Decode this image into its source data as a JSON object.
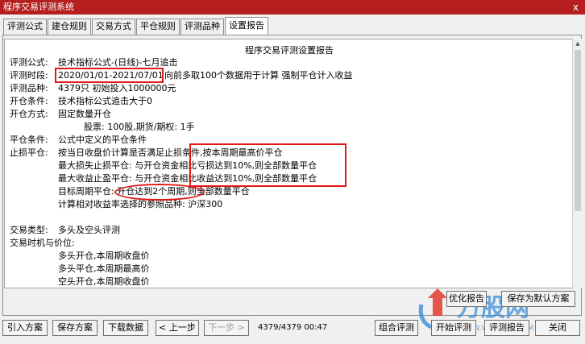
{
  "window": {
    "title": "程序交易评测系统",
    "close": "x"
  },
  "tabs": [
    "评测公式",
    "建仓规则",
    "交易方式",
    "平仓规则",
    "评测品种",
    "设置报告"
  ],
  "report": {
    "title": "程序交易评测设置报告",
    "formula_label": "评测公式:",
    "formula_value": "技术指标公式-(日线)-七月追击",
    "period_label": "评测时段:",
    "period_dates": "2020/01/01-2021/07/01",
    "period_rest": "向前多取100个数据用于计算 强制平仓计入收益",
    "symbols_label": "评测品种:",
    "symbols_value": "4379只 初始投入1000000元",
    "open_cond_label": "开仓条件:",
    "open_cond_value": "技术指标公式追击大于0",
    "open_method_label": "开仓方式:",
    "open_method_value": "固定数量开仓",
    "open_method_detail": "股票: 100股,期货/期权: 1手",
    "close_cond_label": "平仓条件:",
    "close_cond_value": "公式中定义的平仓条件",
    "stop_label": "止损平仓:",
    "stop_line1": "按当日收盘价计算是否满足止损条件,按本周期最高价平仓",
    "stop_line2": "最大损失止损平仓: 与开仓资金相比亏损达到10%,则全部数量平仓",
    "stop_line3": "最大收益止盈平仓: 与开仓资金相比收益达到10%,则全部数量平仓",
    "stop_line4": "目标周期平仓: 开仓达到2个周期,则全部数量平仓",
    "stop_line5": "计算相对收益率选择的参照品种: 沪深300",
    "trade_type_label": "交易类型:",
    "trade_type_value": "多头及空头评测",
    "timing_label": "交易时机与价位:",
    "timing_1": "多头开仓,本周期收盘价",
    "timing_2": "多头平仓,本周期最高价",
    "timing_3": "空头开仓,本周期收盘价"
  },
  "side_buttons": {
    "optimize": "优化报告",
    "save_default": "保存为默认方案"
  },
  "toolbar": {
    "import": "引入方案",
    "save": "保存方案",
    "download": "下载数据",
    "prev": "< 上一步",
    "next": "下一步 >",
    "progress": "4379/4379 00:47",
    "combo": "组合评测",
    "start": "开始评测",
    "report": "评测报告",
    "close": "关闭"
  },
  "watermark": {
    "text": "万股网",
    "subtext": "WWW.WANGU8.COM"
  },
  "colors": {
    "titlebar": "#b51f1f",
    "highlight": "#e01818"
  }
}
